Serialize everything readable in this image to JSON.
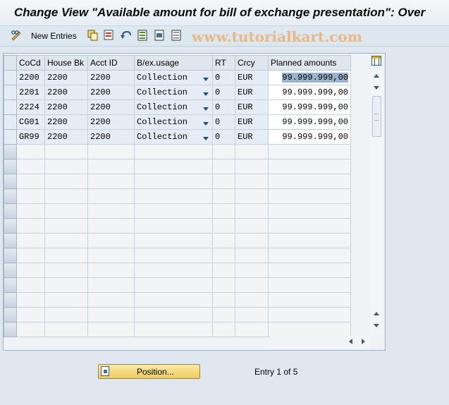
{
  "window": {
    "title": "Change View \"Available amount for bill of exchange presentation\": Over"
  },
  "toolbar": {
    "new_entries_label": "New Entries",
    "icons": [
      "edit-glasses-icon",
      "copy-icon",
      "delete-icon",
      "undo-icon",
      "select-all-icon",
      "select-block-icon",
      "deselect-all-icon"
    ]
  },
  "watermark": "www.tutorialkart.com",
  "table": {
    "headers": [
      "CoCd",
      "House Bk",
      "Acct ID",
      "B/ex.usage",
      "RT",
      "Crcy",
      "Planned amounts"
    ],
    "rows": [
      {
        "cocd": "2200",
        "house_bk": "2200",
        "acct_id": "2200",
        "usage": "Collection",
        "rt": "0",
        "crcy": "EUR",
        "amount": "99.999.999,00"
      },
      {
        "cocd": "2201",
        "house_bk": "2200",
        "acct_id": "2200",
        "usage": "Collection",
        "rt": "0",
        "crcy": "EUR",
        "amount": "99.999.999,00"
      },
      {
        "cocd": "2224",
        "house_bk": "2200",
        "acct_id": "2200",
        "usage": "Collection",
        "rt": "0",
        "crcy": "EUR",
        "amount": "99.999.999,00"
      },
      {
        "cocd": "CG01",
        "house_bk": "2200",
        "acct_id": "2200",
        "usage": "Collection",
        "rt": "0",
        "crcy": "EUR",
        "amount": "99.999.999,00"
      },
      {
        "cocd": "GR99",
        "house_bk": "2200",
        "acct_id": "2200",
        "usage": "Collection",
        "rt": "0",
        "crcy": "EUR",
        "amount": "99.999.999,00"
      }
    ],
    "empty_rows": 13
  },
  "footer": {
    "position_button_label": "Position...",
    "entry_info": "Entry 1 of 5"
  },
  "colors": {
    "accent_button": "#efcc5e",
    "row_bg": "#e4edf6",
    "selection": "#9bb4cd"
  }
}
